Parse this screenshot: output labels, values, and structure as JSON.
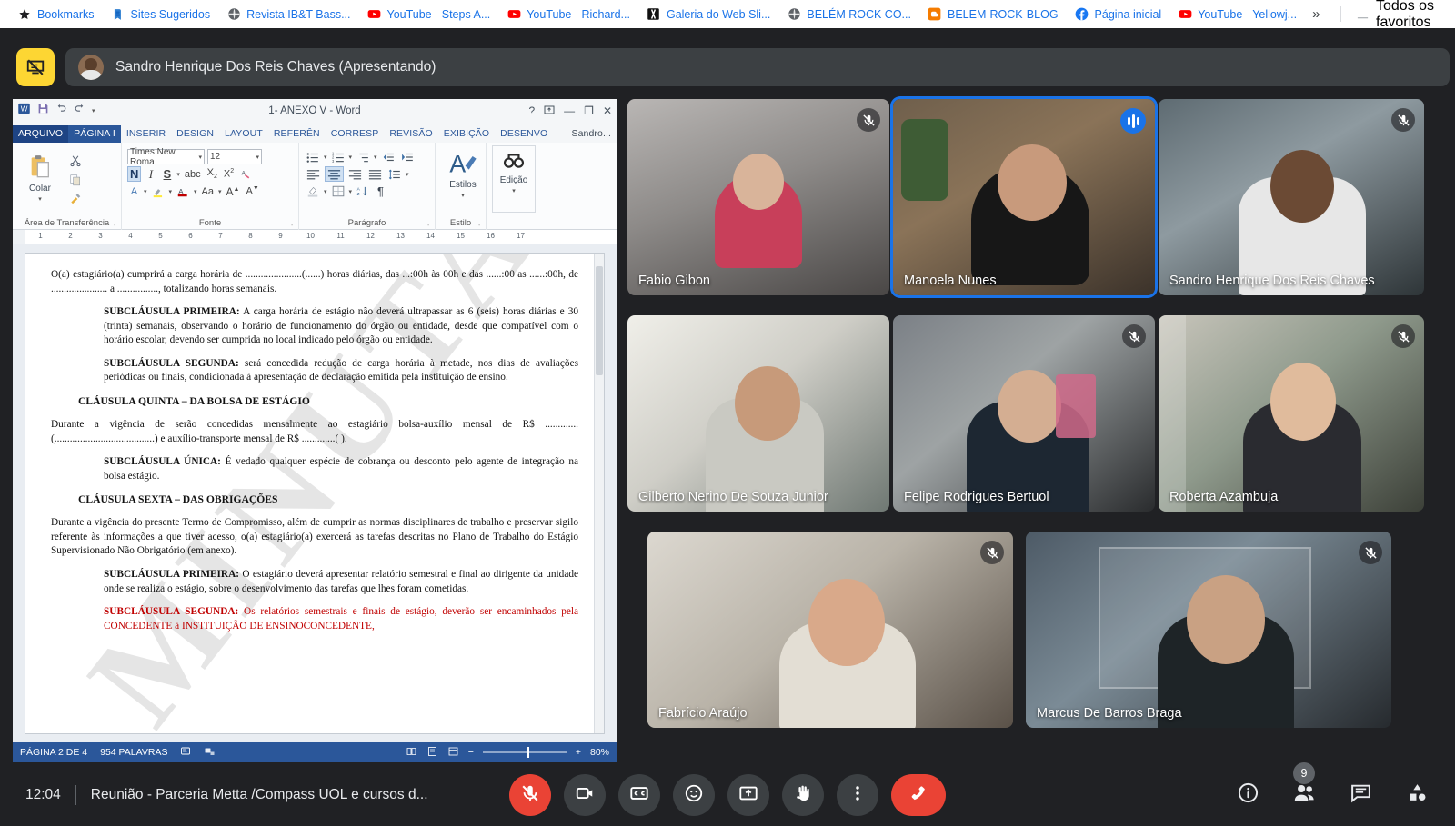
{
  "browser": {
    "bookmarks": [
      {
        "label": "Bookmarks",
        "icon": "star-icon"
      },
      {
        "label": "Sites Sugeridos",
        "icon": "bookmark-blue-icon"
      },
      {
        "label": "Revista IB&T Bass...",
        "icon": "globe-icon"
      },
      {
        "label": "YouTube - Steps A...",
        "icon": "youtube-icon"
      },
      {
        "label": "YouTube - Richard...",
        "icon": "youtube-icon"
      },
      {
        "label": "Galeria do Web Sli...",
        "icon": "gallery-icon"
      },
      {
        "label": "BELÉM ROCK CO...",
        "icon": "globe-icon"
      },
      {
        "label": "BELEM-ROCK-BLOG",
        "icon": "blogger-icon"
      },
      {
        "label": "Página inicial",
        "icon": "facebook-icon"
      },
      {
        "label": "YouTube - Yellowj...",
        "icon": "youtube-icon"
      }
    ],
    "overflow_label": "»",
    "all_favorites_label": "Todos os favoritos"
  },
  "presenter": {
    "stop_present_icon": "stop-presenting-icon",
    "name": "Sandro Henrique Dos Reis Chaves (Apresentando)"
  },
  "word": {
    "title": "1- ANEXO V - Word",
    "quick_access": [
      "save-icon",
      "undo-icon",
      "redo-icon",
      "customize-qat-icon"
    ],
    "window_controls": [
      "help-icon",
      "ribbon-options-icon",
      "minimize-icon",
      "restore-icon",
      "close-icon"
    ],
    "tabs": [
      {
        "label": "ARQUIVO",
        "state": "file"
      },
      {
        "label": "PÁGINA I",
        "state": "active"
      },
      {
        "label": "INSERIR",
        "state": "normal"
      },
      {
        "label": "DESIGN",
        "state": "normal"
      },
      {
        "label": "LAYOUT",
        "state": "normal"
      },
      {
        "label": "REFERÊN",
        "state": "normal"
      },
      {
        "label": "CORRESP",
        "state": "normal"
      },
      {
        "label": "REVISÃO",
        "state": "normal"
      },
      {
        "label": "EXIBIÇÃO",
        "state": "normal"
      },
      {
        "label": "DESENVO",
        "state": "normal"
      },
      {
        "label": "Sandro...",
        "state": "user"
      }
    ],
    "ribbon": {
      "clipboard": {
        "group_label": "Área de Transferência",
        "paste_label": "Colar",
        "buttons": [
          "cut-icon",
          "copy-icon",
          "format-painter-icon"
        ]
      },
      "font": {
        "group_label": "Fonte",
        "font_name": "Times New Roma",
        "font_size": "12",
        "buttons": [
          "bold-icon",
          "italic-icon",
          "underline-icon",
          "strikethrough-icon",
          "subscript-icon",
          "superscript-icon",
          "clear-formatting-icon",
          "text-effects-icon",
          "highlight-icon",
          "font-color-icon",
          "change-case-icon",
          "grow-font-icon",
          "shrink-font-icon"
        ]
      },
      "paragraph": {
        "group_label": "Parágrafo",
        "buttons": [
          "bullets-icon",
          "numbering-icon",
          "multilevel-list-icon",
          "decrease-indent-icon",
          "increase-indent-icon",
          "align-left-icon",
          "align-center-icon",
          "align-right-icon",
          "justify-icon",
          "line-spacing-icon",
          "shading-icon",
          "borders-icon",
          "sort-icon",
          "show-marks-icon"
        ]
      },
      "styles": {
        "group_label": "Estilo",
        "label": "Estilos"
      },
      "editing": {
        "label": "Edição"
      }
    },
    "ruler_marks": [
      "1",
      "2",
      "3",
      "4",
      "5",
      "6",
      "7",
      "8",
      "9",
      "10",
      "11",
      "12",
      "13",
      "14",
      "15",
      "16",
      "17"
    ],
    "watermark": "MINUTA",
    "document": [
      {
        "type": "para",
        "indent": false,
        "text": "O(a) estagiário(a) cumprirá a carga horária de ......................(......) horas diárias, das ...:00h às        00h e das ......:00 as ......:00h, de ...................... a ................, totalizando          horas semanais."
      },
      {
        "type": "para",
        "indent": true,
        "bold": "SUBCLÁUSULA PRIMEIRA:",
        "text": " A carga horária de estágio não deverá ultrapassar as 6 (seis) horas diárias e 30 (trinta) semanais, observando o horário de funcionamento do órgão ou entidade, desde que compatível com o horário escolar, devendo ser cumprida no local indicado pelo órgão ou entidade."
      },
      {
        "type": "para",
        "indent": true,
        "bold": "SUBCLÁUSULA SEGUNDA:",
        "text": " será concedida redução de carga horária à metade, nos dias de avaliações periódicas ou finais, condicionada à apresentação de declaração emitida pela instituição de ensino."
      },
      {
        "type": "heading",
        "text": "CLÁUSULA QUINTA – DA BOLSA DE ESTÁGIO"
      },
      {
        "type": "para",
        "indent": false,
        "text": "Durante a vigência de serão concedidas mensalmente ao estagiário bolsa-auxílio mensal de R$ .............(.......................................) e auxílio-transporte mensal de R$ .............(                                          )."
      },
      {
        "type": "para",
        "indent": true,
        "bold": "SUBCLÁUSULA ÚNICA:",
        "text": " É vedado qualquer espécie de cobrança ou desconto pelo agente de integração na bolsa estágio."
      },
      {
        "type": "heading",
        "text": "CLÁUSULA SEXTA – DAS OBRIGAÇÕES"
      },
      {
        "type": "para",
        "indent": false,
        "text": "Durante a vigência do presente Termo de Compromisso, além de cumprir as normas disciplinares de trabalho e preservar sigilo referente às informações a que tiver acesso, o(a) estagiário(a) exercerá as tarefas descritas no Plano de Trabalho do Estágio Supervisionado Não Obrigatório (em anexo)."
      },
      {
        "type": "para",
        "indent": true,
        "bold": "SUBCLÁUSULA PRIMEIRA:",
        "text": " O estagiário deverá apresentar relatório semestral e final ao dirigente da unidade onde se realiza o estágio, sobre o desenvolvimento das tarefas que lhes foram cometidas."
      },
      {
        "type": "para",
        "indent": true,
        "red": true,
        "bold": "SUBCLÁUSULA SEGUNDA:",
        "text": " Os relatórios semestrais e finais de estágio, deverão ser encaminhados pela CONCEDENTE à INSTITUIÇÃO DE ENSINOCONCEDENTE,"
      }
    ],
    "status": {
      "page": "PÁGINA 2 DE 4",
      "words": "954 PALAVRAS",
      "proofing_icon": "proofing-icon",
      "language_icon": "language-icon",
      "view_icons": [
        "read-mode-icon",
        "print-layout-icon",
        "web-layout-icon"
      ],
      "zoom_out": "−",
      "zoom_in": "+",
      "zoom_level": "80%"
    }
  },
  "tiles": [
    {
      "name": "Fabio Gibon",
      "mic": "muted",
      "speaking": false
    },
    {
      "name": "Manoela Nunes",
      "mic": "active",
      "speaking": true
    },
    {
      "name": "Sandro Henrique Dos Reis Chaves",
      "mic": "muted",
      "speaking": false
    },
    {
      "name": "Gilberto Nerino De Souza Junior",
      "mic": "none",
      "speaking": false
    },
    {
      "name": "Felipe Rodrigues Bertuol",
      "mic": "muted",
      "speaking": false
    },
    {
      "name": "Roberta Azambuja",
      "mic": "muted",
      "speaking": false
    },
    {
      "name": "Fabrício Araújo",
      "mic": "muted",
      "speaking": false
    },
    {
      "name": "Marcus De Barros Braga",
      "mic": "muted",
      "speaking": false
    }
  ],
  "bottom_bar": {
    "time": "12:04",
    "meeting_title": "Reunião - Parceria Metta /Compass UOL e cursos d...",
    "controls": [
      {
        "name": "microphone-off-button",
        "icon": "mic-off-icon",
        "state": "danger"
      },
      {
        "name": "camera-button",
        "icon": "camera-icon",
        "state": "normal"
      },
      {
        "name": "captions-button",
        "icon": "closed-captions-icon",
        "state": "normal"
      },
      {
        "name": "reactions-button",
        "icon": "emoji-icon",
        "state": "normal"
      },
      {
        "name": "present-button",
        "icon": "present-screen-icon",
        "state": "normal"
      },
      {
        "name": "raise-hand-button",
        "icon": "raise-hand-icon",
        "state": "normal"
      },
      {
        "name": "more-options-button",
        "icon": "more-vert-icon",
        "state": "normal"
      },
      {
        "name": "leave-call-button",
        "icon": "hangup-icon",
        "state": "hangup"
      }
    ],
    "right_controls": [
      {
        "name": "meeting-details-button",
        "icon": "info-icon",
        "badge": null
      },
      {
        "name": "participants-button",
        "icon": "people-icon",
        "badge": "9"
      },
      {
        "name": "chat-button",
        "icon": "chat-icon",
        "badge": null
      },
      {
        "name": "activities-button",
        "icon": "activities-icon",
        "badge": null
      }
    ]
  },
  "colors": {
    "accent_blue": "#1a73e8",
    "danger_red": "#ea4335",
    "meet_bg": "#202124",
    "chip_bg": "#3c4043",
    "present_yellow": "#fdd633",
    "word_blue": "#2b579a"
  }
}
